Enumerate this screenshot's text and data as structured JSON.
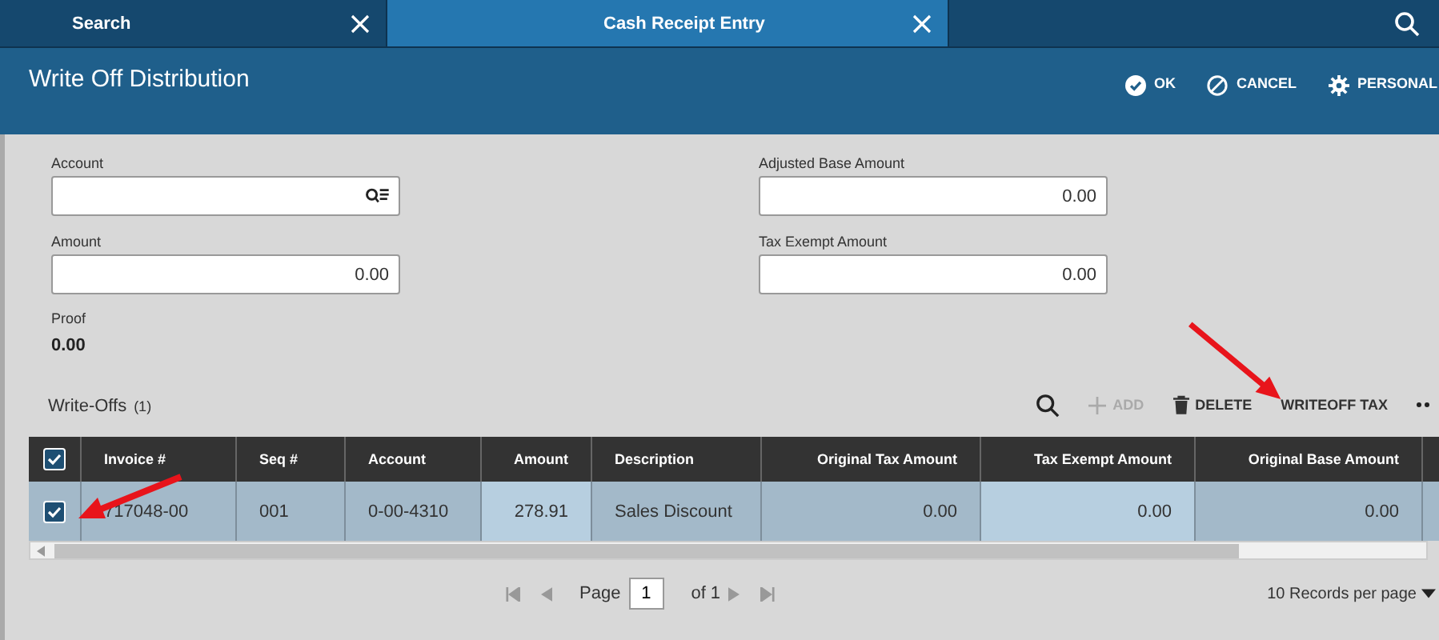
{
  "tabs": [
    {
      "label": "Search",
      "selected": false
    },
    {
      "label": "Cash Receipt Entry",
      "selected": true
    }
  ],
  "header": {
    "title": "Write Off Distribution",
    "actions": [
      {
        "label": "OK",
        "kind": "ok"
      },
      {
        "label": "CANCEL",
        "kind": "cancel"
      },
      {
        "label": "PERSONAL",
        "kind": "personal"
      }
    ]
  },
  "form": {
    "left": [
      {
        "label": "Account",
        "kind": "lookup"
      },
      {
        "label": "Amount",
        "value": "0.00",
        "kind": "number"
      }
    ],
    "right": [
      {
        "label": "Adjusted Base Amount",
        "value": "0.00",
        "kind": "number"
      },
      {
        "label": "Tax Exempt Amount",
        "value": "0.00",
        "kind": "number"
      }
    ],
    "proof": {
      "label": "Proof",
      "value": "0.00"
    }
  },
  "grid": {
    "title": "Write-Offs",
    "count": "(1)",
    "toolbar": [
      {
        "label": "ADD",
        "kind": "add",
        "disabled": true
      },
      {
        "label": "DELETE",
        "kind": "delete",
        "disabled": false
      },
      {
        "label": "WRITEOFF TAX",
        "kind": "text",
        "disabled": false
      }
    ],
    "all_checked": true,
    "columns": [
      {
        "label": "Invoice #",
        "kind": "text",
        "editable": false
      },
      {
        "label": "Seq #",
        "kind": "text",
        "editable": false
      },
      {
        "label": "Account",
        "kind": "text",
        "editable": false
      },
      {
        "label": "Amount",
        "kind": "number",
        "editable": true
      },
      {
        "label": "Description",
        "kind": "text",
        "editable": false
      },
      {
        "label": "Original Tax Amount",
        "kind": "number",
        "editable": false
      },
      {
        "label": "Tax Exempt Amount",
        "kind": "number",
        "editable": true
      },
      {
        "label": "Original Base Amount",
        "kind": "number",
        "editable": false
      }
    ],
    "rows": [
      {
        "checked": true,
        "selected": true,
        "cells": [
          "717048-00",
          "001",
          "0-00-4310",
          "278.91",
          "Sales Discount",
          "0.00",
          "0.00",
          "0.00"
        ]
      }
    ]
  },
  "pager": {
    "page_label": "Page",
    "page": "1",
    "of": "of 1",
    "per_page": "10 Records per page"
  }
}
